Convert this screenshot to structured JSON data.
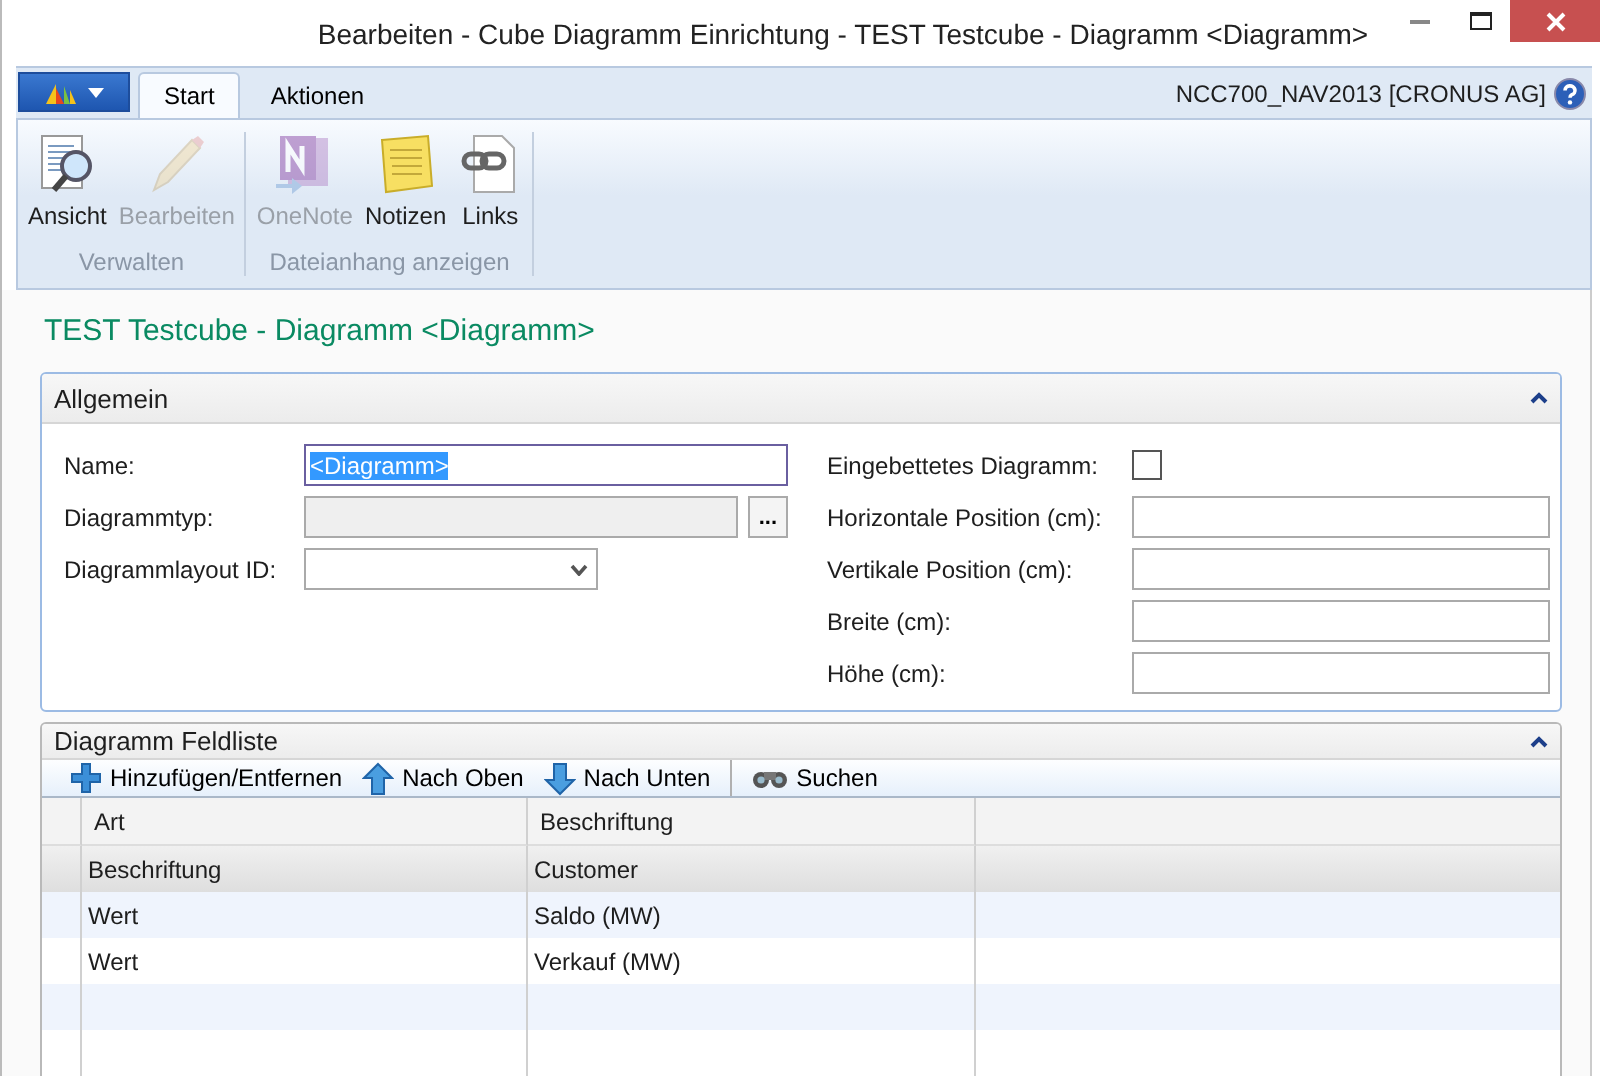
{
  "window": {
    "title": "Bearbeiten - Cube Diagramm Einrichtung - TEST Testcube - Diagramm <Diagramm>"
  },
  "tabs": [
    {
      "label": "Start",
      "selected": true
    },
    {
      "label": "Aktionen",
      "selected": false
    }
  ],
  "company": "NCC700_NAV2013 [CRONUS AG]",
  "ribbon_groups": [
    {
      "label": "Verwalten",
      "buttons": [
        {
          "label": "Ansicht",
          "disabled": false
        },
        {
          "label": "Bearbeiten",
          "disabled": true
        }
      ]
    },
    {
      "label": "Dateianhang anzeigen",
      "buttons": [
        {
          "label": "OneNote",
          "disabled": true
        },
        {
          "label": "Notizen",
          "disabled": false
        },
        {
          "label": "Links",
          "disabled": false
        }
      ]
    }
  ],
  "page_title": "TEST Testcube - Diagramm <Diagramm>",
  "general": {
    "title": "Allgemein",
    "expanded": true,
    "left_fields": [
      {
        "label": "Name:",
        "kind": "text",
        "value": "<Diagramm>",
        "focused": true
      },
      {
        "label": "Diagrammtyp:",
        "kind": "lookup",
        "button": "..."
      },
      {
        "label": "Diagrammlayout ID:",
        "kind": "dropdown"
      }
    ],
    "right_fields": [
      {
        "label": "Eingebettetes Diagramm:",
        "kind": "checkbox",
        "checked": false
      },
      {
        "label": "Horizontale Position (cm):",
        "kind": "text"
      },
      {
        "label": "Vertikale Position (cm):",
        "kind": "text"
      },
      {
        "label": "Breite (cm):",
        "kind": "text"
      },
      {
        "label": "Höhe (cm):",
        "kind": "text"
      }
    ]
  },
  "fields_list": {
    "title": "Diagramm Feldliste",
    "expanded": true,
    "actions": [
      {
        "label": "Hinzufügen/Entfernen"
      },
      {
        "label": "Nach Oben"
      },
      {
        "label": "Nach Unten"
      },
      {
        "label": "Suchen"
      }
    ],
    "columns": [
      "Art",
      "Beschriftung"
    ],
    "rows": [
      {
        "cells": [
          "Beschriftung",
          "Customer"
        ],
        "selected": true
      },
      {
        "cells": [
          "Wert",
          "Saldo (MW)"
        ],
        "selected": false
      },
      {
        "cells": [
          "Wert",
          "Verkauf (MW)"
        ],
        "selected": false
      }
    ]
  }
}
